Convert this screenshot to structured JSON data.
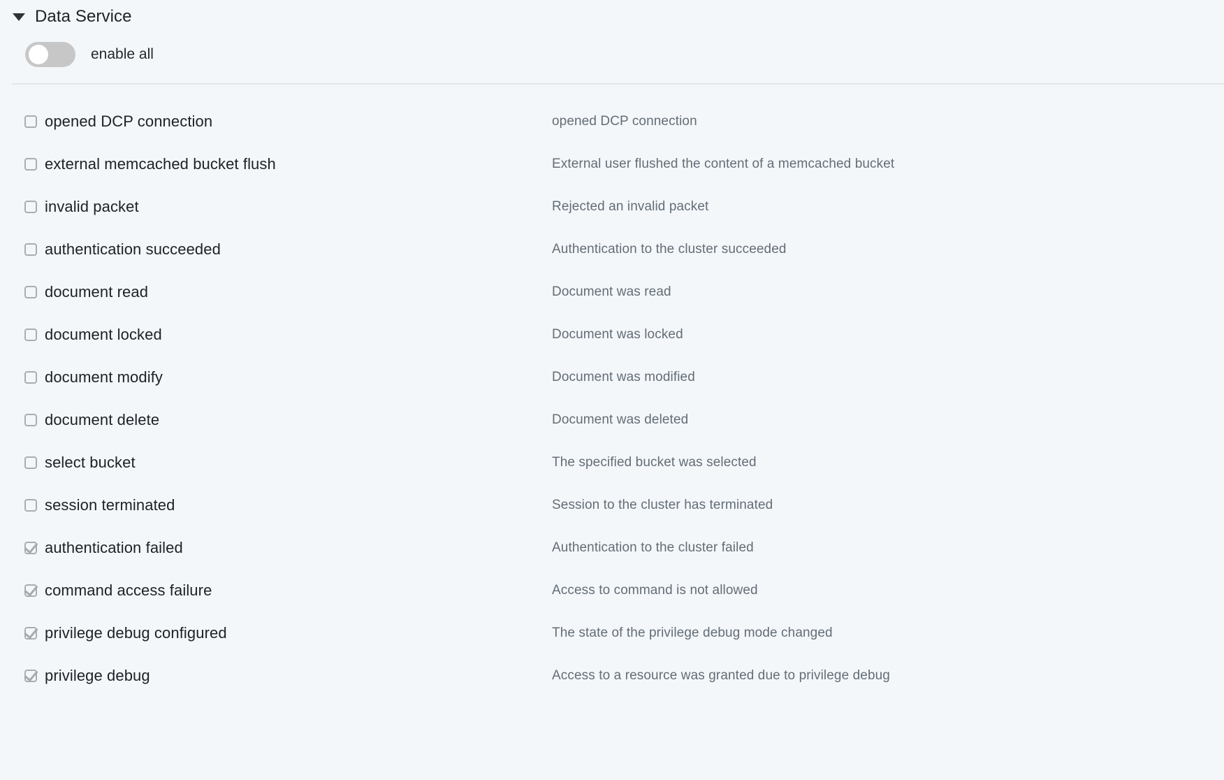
{
  "section": {
    "title": "Data Service",
    "caret_icon": "chevron-down-icon",
    "expanded": true,
    "enable_all": {
      "label": "enable all",
      "checked": false
    }
  },
  "colors": {
    "background": "#f4f7fa",
    "divider": "#e2e6e9",
    "toggle_off": "#c7c7c7",
    "toggle_knob": "#ffffff",
    "checkbox_border": "#a9adb1",
    "check_mark": "#a6aaae",
    "label_text": "#1d2126",
    "description_text": "#636d76"
  },
  "events": [
    {
      "name": "opened DCP connection",
      "description": "opened DCP connection",
      "checked": false
    },
    {
      "name": "external memcached bucket flush",
      "description": "External user flushed the content of a memcached bucket",
      "checked": false
    },
    {
      "name": "invalid packet",
      "description": "Rejected an invalid packet",
      "checked": false
    },
    {
      "name": "authentication succeeded",
      "description": "Authentication to the cluster succeeded",
      "checked": false
    },
    {
      "name": "document read",
      "description": "Document was read",
      "checked": false
    },
    {
      "name": "document locked",
      "description": "Document was locked",
      "checked": false
    },
    {
      "name": "document modify",
      "description": "Document was modified",
      "checked": false
    },
    {
      "name": "document delete",
      "description": "Document was deleted",
      "checked": false
    },
    {
      "name": "select bucket",
      "description": "The specified bucket was selected",
      "checked": false
    },
    {
      "name": "session terminated",
      "description": "Session to the cluster has terminated",
      "checked": false
    },
    {
      "name": "authentication failed",
      "description": "Authentication to the cluster failed",
      "checked": true
    },
    {
      "name": "command access failure",
      "description": "Access to command is not allowed",
      "checked": true
    },
    {
      "name": "privilege debug configured",
      "description": "The state of the privilege debug mode changed",
      "checked": true
    },
    {
      "name": "privilege debug",
      "description": "Access to a resource was granted due to privilege debug",
      "checked": true
    }
  ]
}
